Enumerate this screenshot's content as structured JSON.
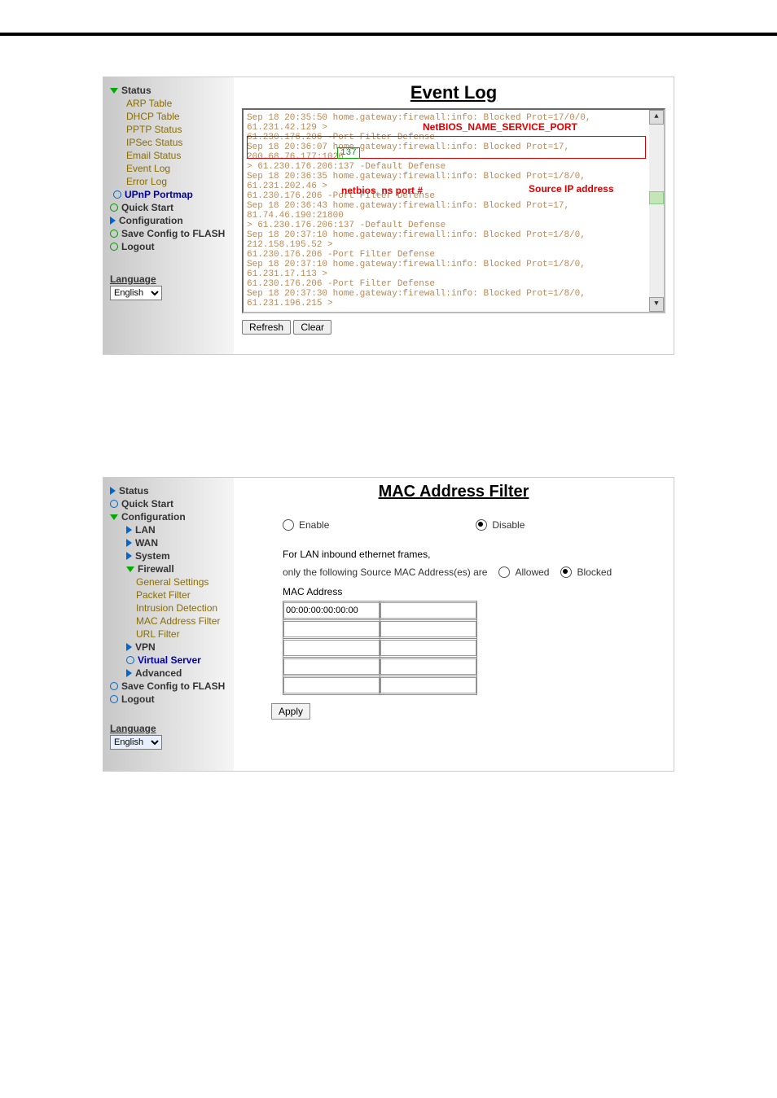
{
  "screenshot1": {
    "sidebar": {
      "status_label": "Status",
      "items": [
        "ARP Table",
        "DHCP Table",
        "PPTP Status",
        "IPSec Status",
        "Email Status",
        "Event Log",
        "Error Log"
      ],
      "upnp": "UPnP Portmap",
      "quick_start": "Quick Start",
      "configuration": "Configuration",
      "save_config": "Save Config to FLASH",
      "logout": "Logout",
      "language_hdr": "Language",
      "language_val": "English"
    },
    "title": "Event Log",
    "log_lines": [
      "Sep 18 20:35:50 home.gateway:firewall:info: Blocked Prot=17/0/0, 61.231.42.129 >",
      "61.230.176.206 -Port Filter Defense",
      "",
      "Sep 18 20:36:07 home.gateway:firewall:info: Blocked Prot=17, 200.68.76.177:1026",
      "> 61.230.176.206:137 -Default Defense",
      "",
      "Sep 18 20:36:35 home.gateway:firewall:info: Blocked Prot=1/8/0, 61.231.202.46 >",
      "61.230.176.206 -Port Filter Defense",
      "",
      "Sep 18 20:36:43 home.gateway:firewall:info: Blocked Prot=17, 81.74.46.190:21800",
      "> 61.230.176.206:137 -Default Defense",
      "",
      "Sep 18 20:37:10 home.gateway:firewall:info: Blocked Prot=1/8/0, 212.158.195.52 >",
      "61.230.176.206 -Port Filter Defense",
      "",
      "Sep 18 20:37:10 home.gateway:firewall:info: Blocked Prot=1/8/0, 61.231.17.113 >",
      "61.230.176.206 -Port Filter Defense",
      "",
      "Sep 18 20:37:30 home.gateway:firewall:info: Blocked Prot=1/8/0, 61.231.196.215 >"
    ],
    "ann_netbios_name": "NetBIOS_NAME_SERVICE_PORT",
    "ann_netbios_port": "netbios_ns port #",
    "ann_source_ip": "Source IP address",
    "btn_refresh": "Refresh",
    "btn_clear": "Clear"
  },
  "screenshot2": {
    "sidebar": {
      "status_label": "Status",
      "quick_start": "Quick Start",
      "configuration": "Configuration",
      "lan": "LAN",
      "wan": "WAN",
      "system": "System",
      "firewall": "Firewall",
      "fw_items": [
        "General Settings",
        "Packet Filter",
        "Intrusion Detection",
        "MAC Address Filter",
        "URL Filter"
      ],
      "vpn": "VPN",
      "virtual_server": "Virtual Server",
      "advanced": "Advanced",
      "save_config": "Save Config to FLASH",
      "logout": "Logout",
      "language_hdr": "Language",
      "language_val": "English"
    },
    "title": "MAC Address Filter",
    "enable": "Enable",
    "disable": "Disable",
    "frames_text": "For LAN inbound ethernet frames,",
    "only_text": "only the following Source MAC Address(es) are",
    "allowed": "Allowed",
    "blocked": "Blocked",
    "mac_hdr": "MAC Address",
    "mac_val": "00:00:00:00:00:00",
    "btn_apply": "Apply"
  }
}
